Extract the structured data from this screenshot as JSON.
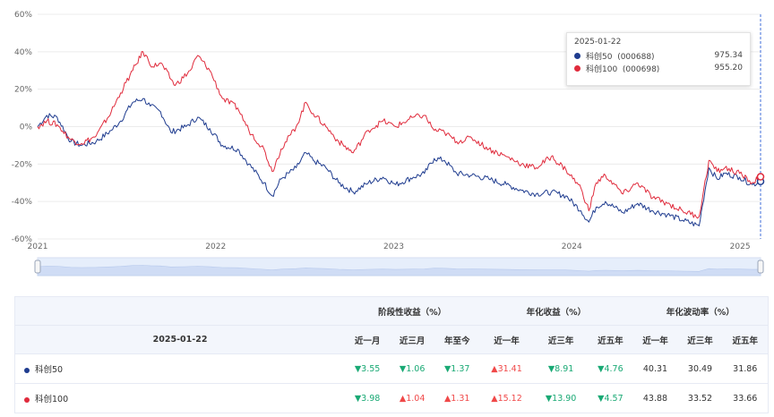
{
  "chart_data": {
    "type": "line",
    "x_range": [
      "2021-01-01",
      "2025-01-22"
    ],
    "x_tick_labels": [
      "2021",
      "2022",
      "2023",
      "2024",
      "2025"
    ],
    "ylim": [
      -60,
      60
    ],
    "y_tick_values": [
      60,
      40,
      20,
      0,
      -20,
      -40,
      -60
    ],
    "y_tick_labels": [
      "60%",
      "40%",
      "20%",
      "0%",
      "-20%",
      "-40%",
      "-60%"
    ],
    "grid": true,
    "series": [
      {
        "name": "科创50",
        "color": "#1f3c8f",
        "points": [
          [
            "2021-01-01",
            0
          ],
          [
            "2021-01-20",
            6
          ],
          [
            "2021-02-10",
            5
          ],
          [
            "2021-03-10",
            -8
          ],
          [
            "2021-04-01",
            -10
          ],
          [
            "2021-05-01",
            -8
          ],
          [
            "2021-06-01",
            -2
          ],
          [
            "2021-06-20",
            3
          ],
          [
            "2021-07-15",
            13
          ],
          [
            "2021-08-05",
            15
          ],
          [
            "2021-08-20",
            11
          ],
          [
            "2021-09-10",
            8
          ],
          [
            "2021-10-01",
            -3
          ],
          [
            "2021-11-01",
            0
          ],
          [
            "2021-11-25",
            5
          ],
          [
            "2021-12-20",
            -1
          ],
          [
            "2022-01-15",
            -10
          ],
          [
            "2022-02-15",
            -12
          ],
          [
            "2022-03-10",
            -20
          ],
          [
            "2022-04-10",
            -30
          ],
          [
            "2022-04-27",
            -37
          ],
          [
            "2022-05-15",
            -28
          ],
          [
            "2022-06-15",
            -22
          ],
          [
            "2022-07-05",
            -14
          ],
          [
            "2022-07-20",
            -18
          ],
          [
            "2022-08-15",
            -22
          ],
          [
            "2022-09-10",
            -30
          ],
          [
            "2022-10-10",
            -35
          ],
          [
            "2022-11-10",
            -30
          ],
          [
            "2022-12-10",
            -27
          ],
          [
            "2023-01-05",
            -31
          ],
          [
            "2023-02-10",
            -27
          ],
          [
            "2023-03-05",
            -25
          ],
          [
            "2023-03-25",
            -17
          ],
          [
            "2023-04-15",
            -18
          ],
          [
            "2023-05-10",
            -25
          ],
          [
            "2023-06-10",
            -26
          ],
          [
            "2023-07-15",
            -28
          ],
          [
            "2023-08-20",
            -31
          ],
          [
            "2023-09-20",
            -34
          ],
          [
            "2023-10-20",
            -36
          ],
          [
            "2023-11-20",
            -35
          ],
          [
            "2023-12-20",
            -37
          ],
          [
            "2024-01-20",
            -45
          ],
          [
            "2024-02-05",
            -51
          ],
          [
            "2024-02-20",
            -43
          ],
          [
            "2024-03-10",
            -40
          ],
          [
            "2024-04-15",
            -46
          ],
          [
            "2024-05-15",
            -41
          ],
          [
            "2024-06-15",
            -45
          ],
          [
            "2024-07-15",
            -47
          ],
          [
            "2024-08-15",
            -50
          ],
          [
            "2024-09-18",
            -53
          ],
          [
            "2024-09-25",
            -42
          ],
          [
            "2024-10-08",
            -22
          ],
          [
            "2024-10-25",
            -28
          ],
          [
            "2024-11-10",
            -25
          ],
          [
            "2024-12-10",
            -27
          ],
          [
            "2025-01-05",
            -31
          ],
          [
            "2025-01-22",
            -29.3
          ]
        ]
      },
      {
        "name": "科创100",
        "color": "#e02b3c",
        "points": [
          [
            "2021-01-01",
            0
          ],
          [
            "2021-01-20",
            3
          ],
          [
            "2021-02-10",
            1
          ],
          [
            "2021-03-10",
            -7
          ],
          [
            "2021-04-01",
            -9
          ],
          [
            "2021-05-01",
            -5
          ],
          [
            "2021-06-01",
            8
          ],
          [
            "2021-06-20",
            18
          ],
          [
            "2021-07-15",
            30
          ],
          [
            "2021-08-05",
            40
          ],
          [
            "2021-08-25",
            32
          ],
          [
            "2021-09-10",
            34
          ],
          [
            "2021-10-10",
            22
          ],
          [
            "2021-11-10",
            30
          ],
          [
            "2021-11-25",
            38
          ],
          [
            "2021-12-20",
            30
          ],
          [
            "2022-01-15",
            15
          ],
          [
            "2022-02-15",
            10
          ],
          [
            "2022-03-10",
            -2
          ],
          [
            "2022-04-10",
            -12
          ],
          [
            "2022-04-27",
            -24
          ],
          [
            "2022-05-15",
            -12
          ],
          [
            "2022-06-15",
            0
          ],
          [
            "2022-07-05",
            13
          ],
          [
            "2022-07-20",
            7
          ],
          [
            "2022-08-15",
            0
          ],
          [
            "2022-09-10",
            -8
          ],
          [
            "2022-10-10",
            -14
          ],
          [
            "2022-11-10",
            -2
          ],
          [
            "2022-12-10",
            3
          ],
          [
            "2023-01-05",
            0
          ],
          [
            "2023-02-10",
            5
          ],
          [
            "2023-03-05",
            6
          ],
          [
            "2023-03-25",
            -2
          ],
          [
            "2023-04-15",
            -3
          ],
          [
            "2023-05-10",
            -8
          ],
          [
            "2023-06-10",
            -6
          ],
          [
            "2023-07-15",
            -12
          ],
          [
            "2023-08-20",
            -16
          ],
          [
            "2023-09-20",
            -20
          ],
          [
            "2023-10-20",
            -22
          ],
          [
            "2023-11-20",
            -16
          ],
          [
            "2023-12-20",
            -23
          ],
          [
            "2024-01-20",
            -33
          ],
          [
            "2024-02-05",
            -45
          ],
          [
            "2024-02-20",
            -30
          ],
          [
            "2024-03-10",
            -26
          ],
          [
            "2024-04-15",
            -36
          ],
          [
            "2024-05-15",
            -30
          ],
          [
            "2024-06-15",
            -38
          ],
          [
            "2024-07-15",
            -41
          ],
          [
            "2024-08-15",
            -45
          ],
          [
            "2024-09-18",
            -48
          ],
          [
            "2024-09-25",
            -38
          ],
          [
            "2024-10-08",
            -18
          ],
          [
            "2024-10-25",
            -24
          ],
          [
            "2024-11-10",
            -22
          ],
          [
            "2024-12-10",
            -25
          ],
          [
            "2025-01-05",
            -30
          ],
          [
            "2025-01-22",
            -26.8
          ]
        ]
      }
    ]
  },
  "tooltip": {
    "date": "2025-01-22",
    "rows": [
      {
        "name": "科创50",
        "code": "(000688)",
        "value": "975.34",
        "color": "#1f3c8f"
      },
      {
        "name": "科创100",
        "code": "(000698)",
        "value": "955.20",
        "color": "#e02b3c"
      }
    ]
  },
  "table": {
    "group_headers": [
      "阶段性收益（%）",
      "年化收益（%）",
      "年化波动率（%）"
    ],
    "date_label": "2025-01-22",
    "columns": [
      "近一月",
      "近三月",
      "年至今",
      "近一年",
      "近三年",
      "近五年",
      "近一年",
      "近三年",
      "近五年"
    ],
    "rows": [
      {
        "name": "科创50",
        "color": "#1f3c8f",
        "cells": [
          {
            "text": "▼3.55",
            "dir": "down"
          },
          {
            "text": "▼1.06",
            "dir": "down"
          },
          {
            "text": "▼1.37",
            "dir": "down"
          },
          {
            "text": "▲31.41",
            "dir": "up"
          },
          {
            "text": "▼8.91",
            "dir": "down"
          },
          {
            "text": "▼4.76",
            "dir": "down"
          },
          {
            "text": "40.31",
            "dir": "flat"
          },
          {
            "text": "30.49",
            "dir": "flat"
          },
          {
            "text": "31.86",
            "dir": "flat"
          }
        ]
      },
      {
        "name": "科创100",
        "color": "#e02b3c",
        "cells": [
          {
            "text": "▼3.98",
            "dir": "down"
          },
          {
            "text": "▲1.04",
            "dir": "up"
          },
          {
            "text": "▲1.31",
            "dir": "up"
          },
          {
            "text": "▲15.12",
            "dir": "up"
          },
          {
            "text": "▼13.90",
            "dir": "down"
          },
          {
            "text": "▼4.57",
            "dir": "down"
          },
          {
            "text": "43.88",
            "dir": "flat"
          },
          {
            "text": "33.52",
            "dir": "flat"
          },
          {
            "text": "33.66",
            "dir": "flat"
          }
        ]
      }
    ]
  }
}
